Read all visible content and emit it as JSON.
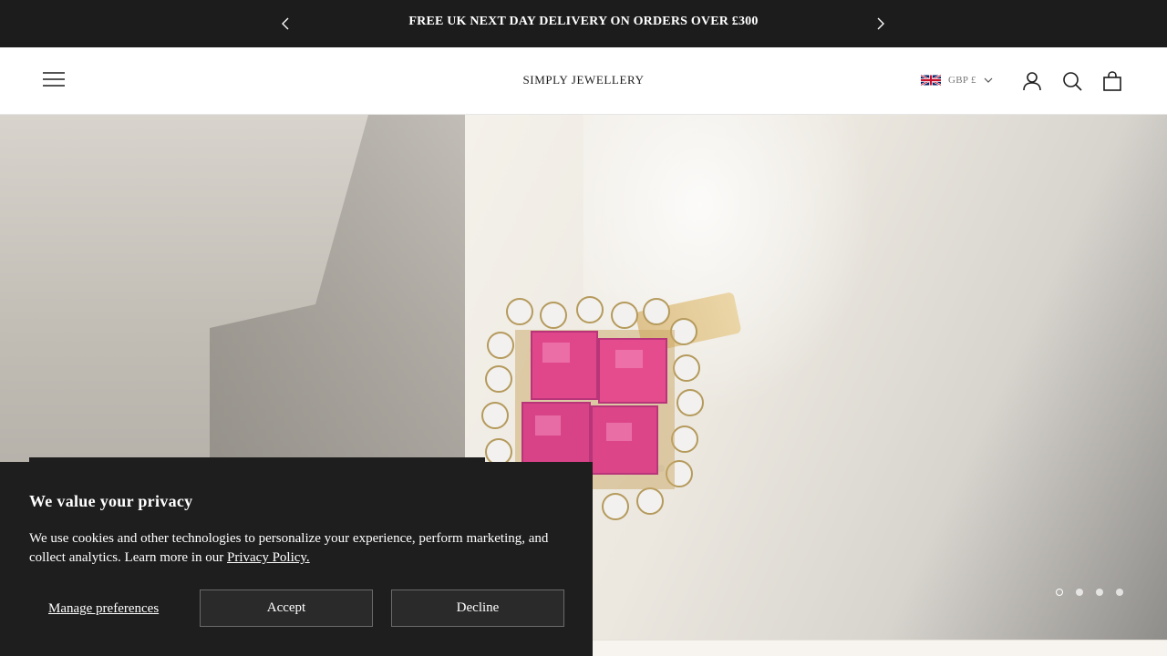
{
  "announcement": {
    "message": "FREE UK NEXT DAY DELIVERY ON ORDERS OVER £300",
    "prev_icon": "chevron-left-icon",
    "next_icon": "chevron-right-icon"
  },
  "header": {
    "logo": "SIMPLY JEWELLERY",
    "currency": {
      "flag": "uk-flag-icon",
      "label": "GBP £"
    },
    "icons": [
      "hamburger-menu-icon",
      "account-icon",
      "search-icon",
      "cart-icon"
    ]
  },
  "hero": {
    "slides_count": 4,
    "active_slide": 1
  },
  "cookie_banner": {
    "title": "We value your privacy",
    "body_text": "We use cookies and other technologies to personalize your experience, perform marketing, and collect analytics. Learn more in our ",
    "policy_link": "Privacy Policy.",
    "manage_label": "Manage preferences",
    "accept_label": "Accept",
    "decline_label": "Decline"
  },
  "colors": {
    "bar_background": "#1c1c1c",
    "header_background": "#ffffff",
    "banner_background": "#1e1e1e",
    "ruby": "#e0468a"
  }
}
